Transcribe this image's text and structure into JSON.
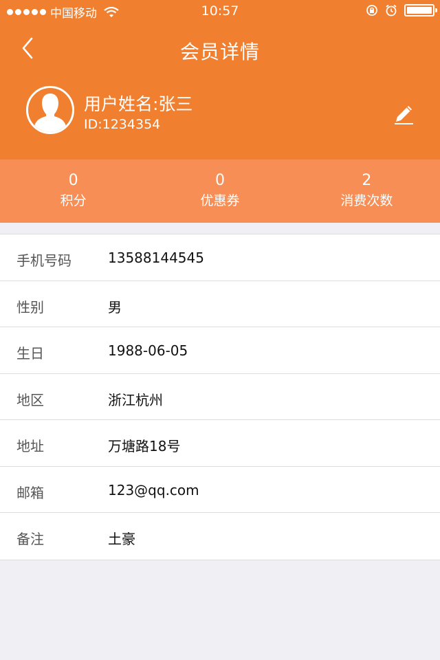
{
  "status_bar": {
    "carrier": "中国移动",
    "time": "10:57",
    "icons": [
      "signal-icon",
      "wifi-icon",
      "orientation-lock-icon",
      "alarm-icon",
      "battery-icon"
    ]
  },
  "nav": {
    "title": "会员详情",
    "back_icon": "chevron-left-icon"
  },
  "profile": {
    "name": "用户姓名:张三",
    "id": "ID:1234354",
    "avatar_icon": "user-avatar-icon",
    "edit_icon": "pencil-icon"
  },
  "stats": [
    {
      "value": "0",
      "label": "积分"
    },
    {
      "value": "0",
      "label": "优惠券"
    },
    {
      "value": "2",
      "label": "消费次数"
    }
  ],
  "info": [
    {
      "label": "手机号码",
      "value": "13588144545"
    },
    {
      "label": "性别",
      "value": "男"
    },
    {
      "label": "生日",
      "value": "1988-06-05"
    },
    {
      "label": "地区",
      "value": "浙江杭州"
    },
    {
      "label": "地址",
      "value": "万塘路18号"
    },
    {
      "label": "邮箱",
      "value": "123@qq.com"
    },
    {
      "label": "备注",
      "value": "土豪"
    }
  ],
  "colors": {
    "header": "#f07f2f",
    "stats_bar": "#f68e55",
    "background": "#efeff4"
  }
}
